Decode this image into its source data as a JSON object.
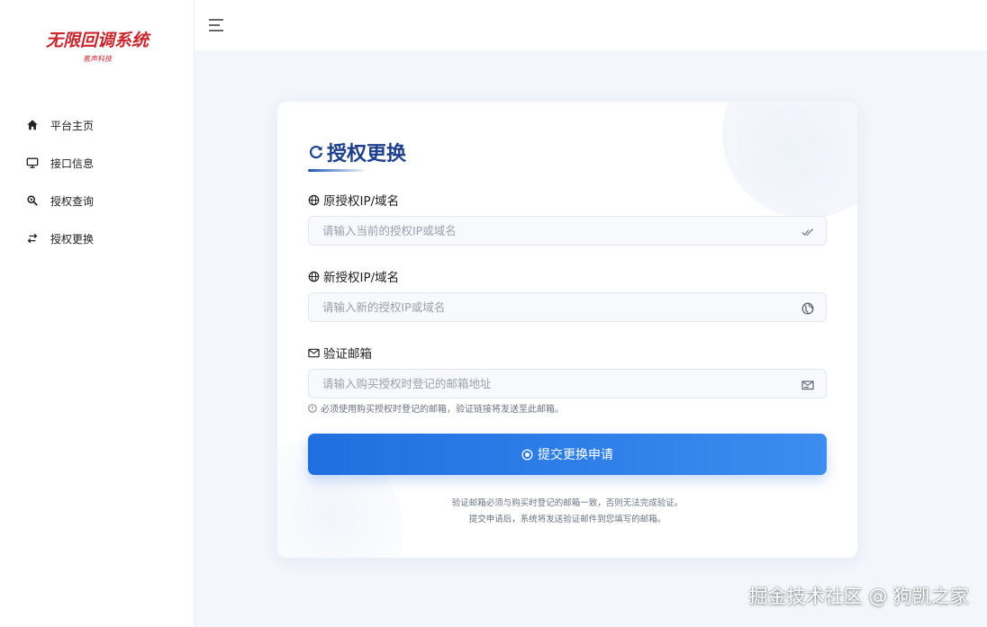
{
  "sidebar": {
    "brand_title": "无限回调系统",
    "brand_subtitle": "氪声科技",
    "items": [
      {
        "label": "平台主页",
        "icon": "home-icon"
      },
      {
        "label": "接口信息",
        "icon": "monitor-icon"
      },
      {
        "label": "授权查询",
        "icon": "search-icon"
      },
      {
        "label": "授权更换",
        "icon": "swap-icon"
      }
    ]
  },
  "topbar": {
    "menu_icon": "menu-icon"
  },
  "card": {
    "title": "授权更换",
    "title_icon": "refresh-icon",
    "fields": [
      {
        "label": "原授权IP/域名",
        "placeholder": "请输入当前的授权IP或域名",
        "label_icon": "globe-icon",
        "input_icon": "double-check-icon"
      },
      {
        "label": "新授权IP/域名",
        "placeholder": "请输入新的授权IP或域名",
        "label_icon": "globe-icon",
        "input_icon": "globe-solid-icon"
      },
      {
        "label": "验证邮箱",
        "placeholder": "请输入购买授权时登记的邮箱地址",
        "label_icon": "mail-icon",
        "input_icon": "mail-send-icon"
      }
    ],
    "email_hint": "必须使用购买授权时登记的邮箱，验证链接将发送至此邮箱。",
    "submit_label": "提交更换申请",
    "notes": [
      "验证邮箱必须与购买时登记的邮箱一致，否则无法完成验证。",
      "提交申请后，系统将发送验证邮件到您填写的邮箱。"
    ]
  },
  "watermark": "掘金技术社区 @ 狗凯之家",
  "colors": {
    "brand": "#c8272d",
    "title": "#1e3f8a",
    "button_start": "#1f6fe0",
    "button_end": "#3d8cf0",
    "background": "#f3f6fb"
  }
}
